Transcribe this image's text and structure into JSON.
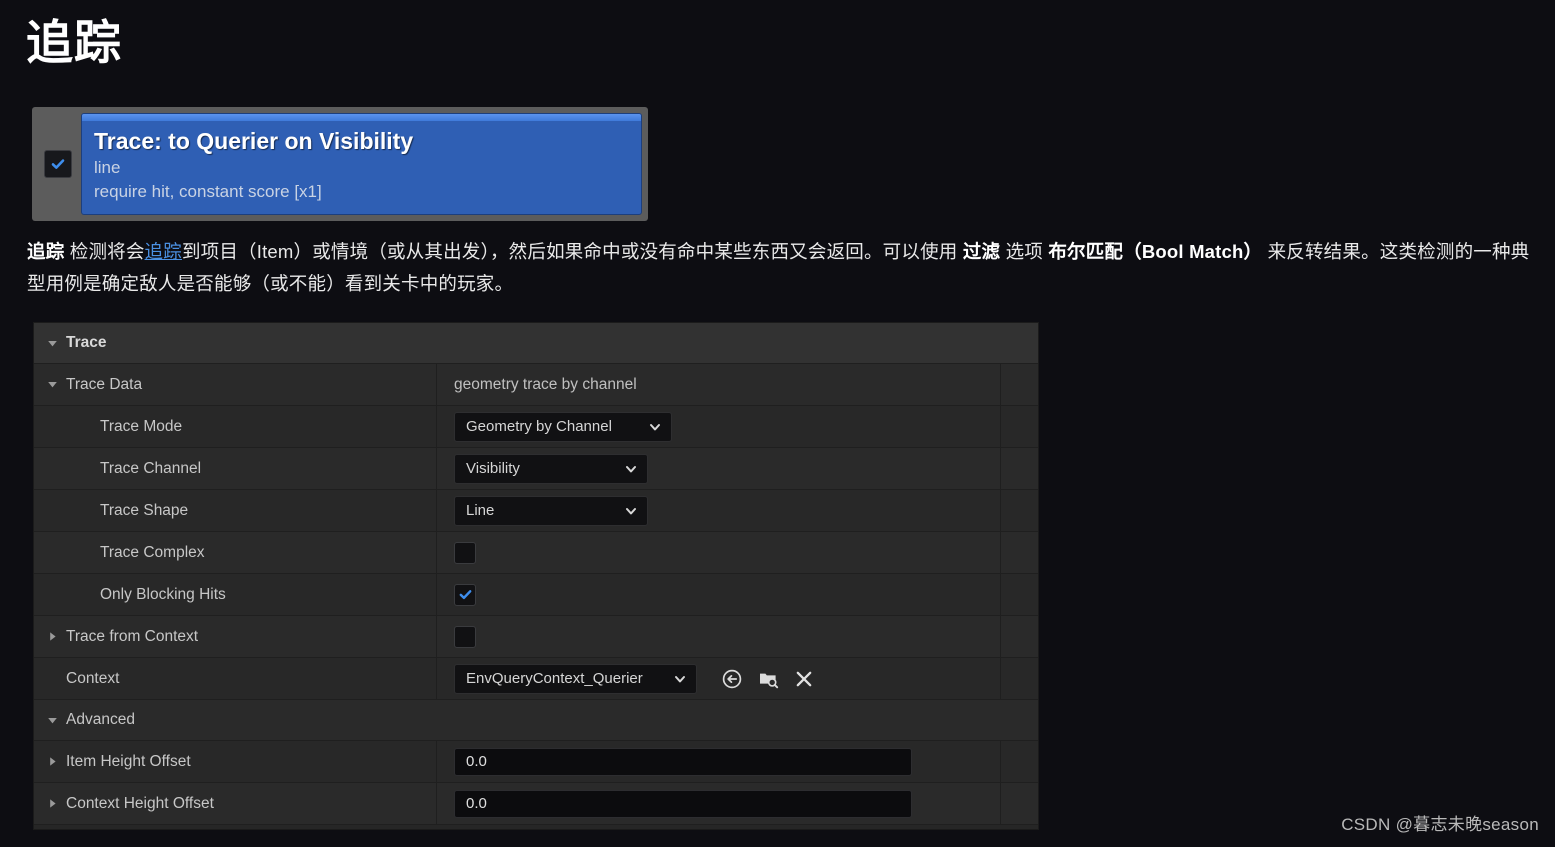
{
  "page": {
    "title": "追踪",
    "background_color": "#0d0d12"
  },
  "node_card": {
    "enabled_checkbox": true,
    "title": "Trace: to Querier on Visibility",
    "line1": "line",
    "line2": "require hit, constant score [x1]",
    "accent_color": "#2f5fb4",
    "stripe_color": "#5b93ee"
  },
  "paragraph": {
    "bold_lead": "追踪",
    "t1": " 检测将会",
    "link": "追踪",
    "t2": "到项目（Item）或情境（或从其出发），然后如果命中或没有命中某些东西又会返回。可以使用 ",
    "bold1": "过滤",
    "t3": " 选项 ",
    "bold2": "布尔匹配（Bool Match）",
    "t4": " 来反转结果。这类检测的一种典型用例是确定敌人是否能够（或不能）看到关卡中的玩家。",
    "link_color": "#4a90e2"
  },
  "details_panel": {
    "rows": [
      {
        "kind": "category",
        "label": "Trace",
        "expander": "down",
        "value": ""
      },
      {
        "kind": "subcategory",
        "label": "Trace Data",
        "expander": "down",
        "value": "geometry trace by channel"
      },
      {
        "kind": "property",
        "label": "Trace Mode",
        "control": "combo",
        "value": "Geometry by Channel"
      },
      {
        "kind": "property",
        "label": "Trace Channel",
        "control": "combo",
        "value": "Visibility"
      },
      {
        "kind": "property",
        "label": "Trace Shape",
        "control": "combo",
        "value": "Line"
      },
      {
        "kind": "property",
        "label": "Trace Complex",
        "control": "checkbox",
        "checked": false
      },
      {
        "kind": "property",
        "label": "Only Blocking Hits",
        "control": "checkbox",
        "checked": true
      },
      {
        "kind": "property",
        "label": "Trace from Context",
        "expander": "right",
        "control": "checkbox",
        "checked": false
      },
      {
        "kind": "property",
        "label": "Context",
        "control": "asset-picker",
        "value": "EnvQueryContext_Querier"
      },
      {
        "kind": "category2",
        "label": "Advanced",
        "expander": "down",
        "value": ""
      },
      {
        "kind": "property",
        "label": "Item Height Offset",
        "expander": "right",
        "control": "number",
        "value": "0.0"
      },
      {
        "kind": "property",
        "label": "Context Height Offset",
        "expander": "right",
        "control": "number",
        "value": "0.0"
      }
    ],
    "asset_picker_icons": [
      {
        "name": "use-selected-asset-icon"
      },
      {
        "name": "browse-to-asset-icon"
      },
      {
        "name": "clear-asset-icon"
      }
    ]
  },
  "watermark": {
    "text": "CSDN @暮志未晚season"
  }
}
